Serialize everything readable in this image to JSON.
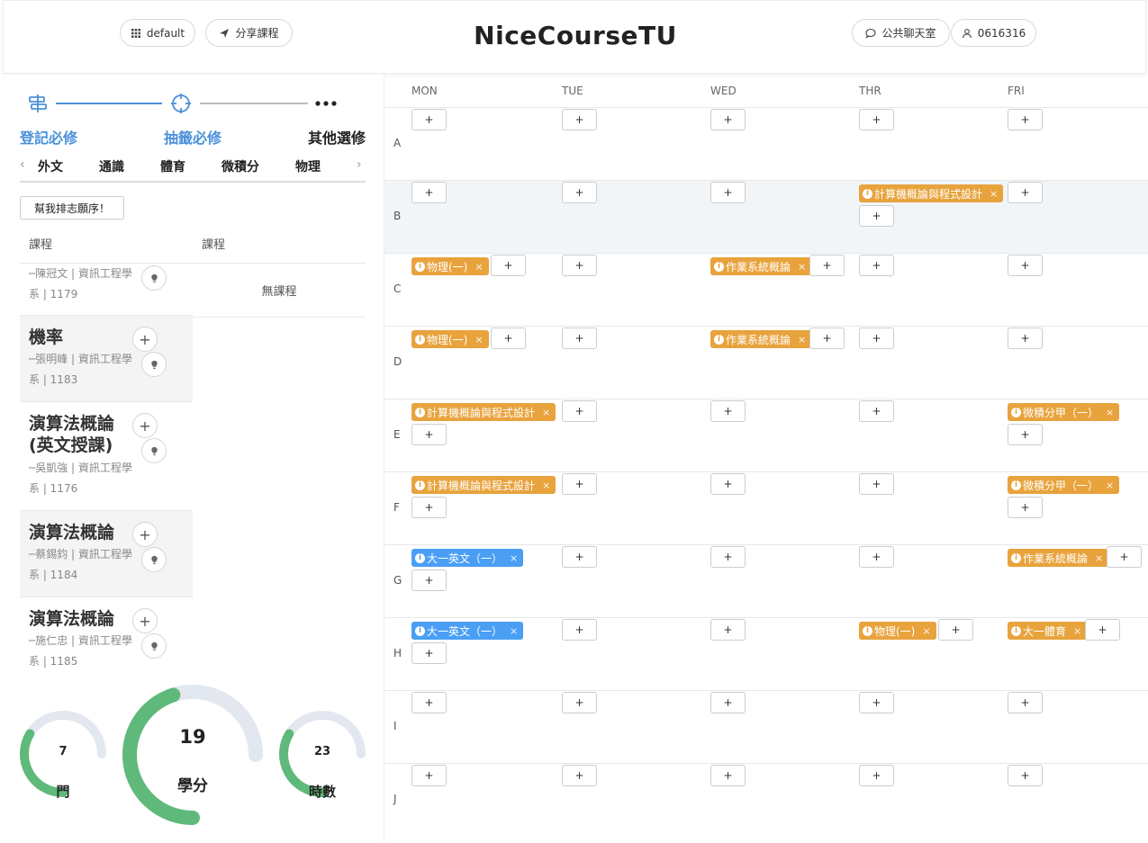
{
  "header": {
    "default_label": "default",
    "share_label": "分享課程",
    "logo": "NiceCourseTU",
    "chat_label": "公共聊天室",
    "user_label": "0616316"
  },
  "steps": {
    "labels": [
      "登記必修",
      "抽籤必修",
      "其他選修"
    ],
    "active_color": "#4a90d9",
    "inactive_color": "#222222"
  },
  "tabs": [
    "外文",
    "通識",
    "體育",
    "微積分",
    "物理"
  ],
  "rank_button": "幫我排志願序！",
  "columns": [
    "課程",
    "課程"
  ],
  "empty_text": "無課程",
  "courses": [
    {
      "title": "",
      "teacher": "─陳冠文 | 資訊工程學系 | 1179"
    },
    {
      "title": "機率",
      "teacher": "─張明峰 | 資訊工程學系 | 1183"
    },
    {
      "title": "演算法概論(英文授課)",
      "teacher": "─吳凱強 | 資訊工程學系 | 1176"
    },
    {
      "title": "演算法概論",
      "teacher": "─蔡錫鈞 | 資訊工程學系 | 1184"
    },
    {
      "title": "演算法概論",
      "teacher": "─施仁忠 | 資訊工程學系 | 1185"
    }
  ],
  "stats": {
    "courses": {
      "value": "7",
      "label": "門",
      "fraction": 0.45
    },
    "credits": {
      "value": "19",
      "label": "學分",
      "fraction": 0.6
    },
    "hours": {
      "value": "23",
      "label": "時數",
      "fraction": 0.45
    },
    "fill_color": "#5fb97a",
    "track_color": "#e2e7f0"
  },
  "schedule": {
    "days": [
      "MON",
      "TUE",
      "WED",
      "THR",
      "FRI"
    ],
    "periods": [
      "A",
      "B",
      "C",
      "D",
      "E",
      "F",
      "G",
      "H",
      "I",
      "J"
    ],
    "highlight_period": "B",
    "add_label": "+",
    "close_label": "×",
    "info_label": "i",
    "colors": {
      "orange": "#e8a33d",
      "blue": "#4a9ff5"
    },
    "entries": [
      {
        "period": "B",
        "day": "THR",
        "name": "計算機概論與程式設計",
        "color": "orange"
      },
      {
        "period": "C",
        "day": "MON",
        "name": "物理(一)",
        "color": "orange"
      },
      {
        "period": "C",
        "day": "WED",
        "name": "作業系統概論",
        "color": "orange"
      },
      {
        "period": "D",
        "day": "MON",
        "name": "物理(一)",
        "color": "orange"
      },
      {
        "period": "D",
        "day": "WED",
        "name": "作業系統概論",
        "color": "orange"
      },
      {
        "period": "E",
        "day": "MON",
        "name": "計算機概論與程式設計",
        "color": "orange"
      },
      {
        "period": "E",
        "day": "FRI",
        "name": "微積分甲（一）",
        "color": "orange"
      },
      {
        "period": "F",
        "day": "MON",
        "name": "計算機概論與程式設計",
        "color": "orange"
      },
      {
        "period": "F",
        "day": "FRI",
        "name": "微積分甲（一）",
        "color": "orange"
      },
      {
        "period": "G",
        "day": "MON",
        "name": "大一英文（一）",
        "color": "blue"
      },
      {
        "period": "G",
        "day": "FRI",
        "name": "作業系統概論",
        "color": "orange"
      },
      {
        "period": "H",
        "day": "MON",
        "name": "大一英文（一）",
        "color": "blue"
      },
      {
        "period": "H",
        "day": "THR",
        "name": "物理(一)",
        "color": "orange"
      },
      {
        "period": "H",
        "day": "FRI",
        "name": "大一體育",
        "color": "orange"
      }
    ]
  }
}
